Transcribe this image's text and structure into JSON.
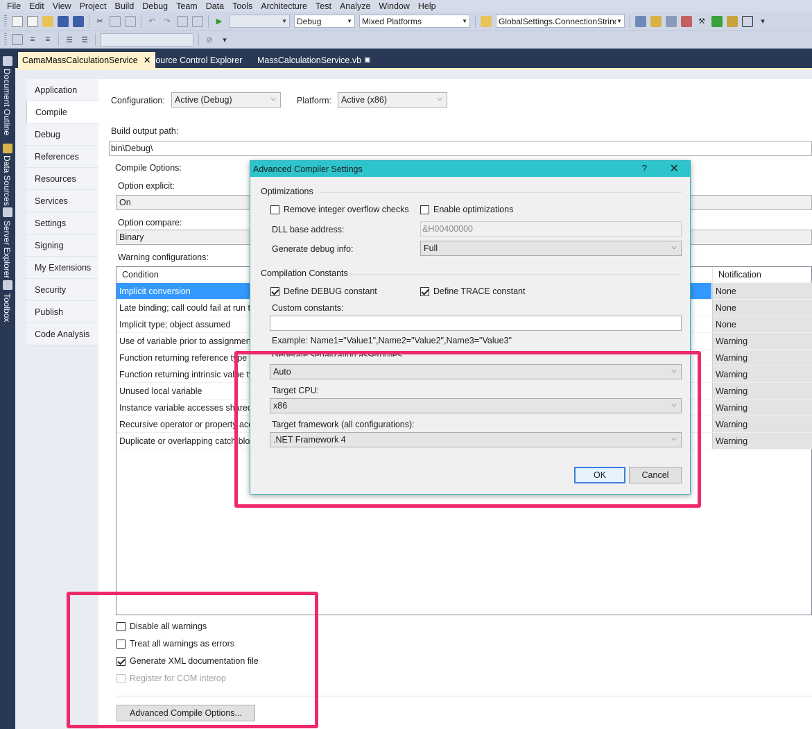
{
  "menu": [
    "File",
    "Edit",
    "View",
    "Project",
    "Build",
    "Debug",
    "Team",
    "Data",
    "Tools",
    "Architecture",
    "Test",
    "Analyze",
    "Window",
    "Help"
  ],
  "toolbar": {
    "config_combo": "Debug",
    "platform_combo": "Mixed Platforms",
    "find_combo": "GlobalSettings.ConnectionStrinc"
  },
  "side_tabs": [
    "Document Outline",
    "Data Sources",
    "Server Explorer",
    "Toolbox"
  ],
  "doc_tabs": [
    {
      "label": "CamaMassCalculationService",
      "active": true
    },
    {
      "label": "Source Control Explorer",
      "active": false
    },
    {
      "label": "MassCalculationService.vb",
      "active": false
    }
  ],
  "nav": [
    "Application",
    "Compile",
    "Debug",
    "References",
    "Resources",
    "Services",
    "Settings",
    "Signing",
    "My Extensions",
    "Security",
    "Publish",
    "Code Analysis"
  ],
  "compile": {
    "configuration_label": "Configuration:",
    "configuration_value": "Active (Debug)",
    "platform_label": "Platform:",
    "platform_value": "Active (x86)",
    "output_label": "Build output path:",
    "output_value": "bin\\Debug\\",
    "options_label": "Compile Options:",
    "explicit_label": "Option explicit:",
    "explicit_value": "On",
    "compare_label": "Option compare:",
    "compare_value": "Binary",
    "warnings_label": "Warning configurations:",
    "col_condition": "Condition",
    "col_notification": "Notification",
    "rows": [
      {
        "condition": "Implicit conversion",
        "notification": "None"
      },
      {
        "condition": "Late binding; call could fail at run time",
        "notification": "None"
      },
      {
        "condition": "Implicit type; object assumed",
        "notification": "None"
      },
      {
        "condition": "Use of variable prior to assignment",
        "notification": "Warning"
      },
      {
        "condition": "Function returning reference type without return value",
        "notification": "Warning"
      },
      {
        "condition": "Function returning intrinsic value type without return value",
        "notification": "Warning"
      },
      {
        "condition": "Unused local variable",
        "notification": "Warning"
      },
      {
        "condition": "Instance variable accesses shared member",
        "notification": "Warning"
      },
      {
        "condition": "Recursive operator or property access",
        "notification": "Warning"
      },
      {
        "condition": "Duplicate or overlapping catch blocks",
        "notification": "Warning"
      }
    ],
    "disable_warnings": "Disable all warnings",
    "warnings_as_errors": "Treat all warnings as errors",
    "generate_xml": "Generate XML documentation file",
    "register_com": "Register for COM interop",
    "advanced_button": "Advanced Compile Options..."
  },
  "dialog": {
    "title": "Advanced Compiler Settings",
    "help": "?",
    "close": "✕",
    "optimizations": "Optimizations",
    "remove_overflow": "Remove integer overflow checks",
    "enable_opt": "Enable optimizations",
    "dll_label": "DLL base address:",
    "dll_value": "&H00400000",
    "debug_info_label": "Generate debug info:",
    "debug_info_value": "Full",
    "constants": "Compilation Constants",
    "define_debug": "Define DEBUG constant",
    "define_trace": "Define TRACE constant",
    "custom_label": "Custom constants:",
    "custom_value": "",
    "example": "Example: Name1=\"Value1\",Name2=\"Value2\",Name3=\"Value3\"",
    "serialization_label": "Generate serialization assemblies:",
    "serialization_value": "Auto",
    "cpu_label": "Target CPU:",
    "cpu_value": "x86",
    "framework_label": "Target framework (all configurations):",
    "framework_value": ".NET Framework 4",
    "ok": "OK",
    "cancel": "Cancel"
  },
  "colors": {
    "highlight": "#ee2a6b",
    "dialog_title": "#2ec4cc",
    "selection": "#3399ff",
    "ide_dark": "#293955",
    "active_tab": "#fff2cc"
  }
}
